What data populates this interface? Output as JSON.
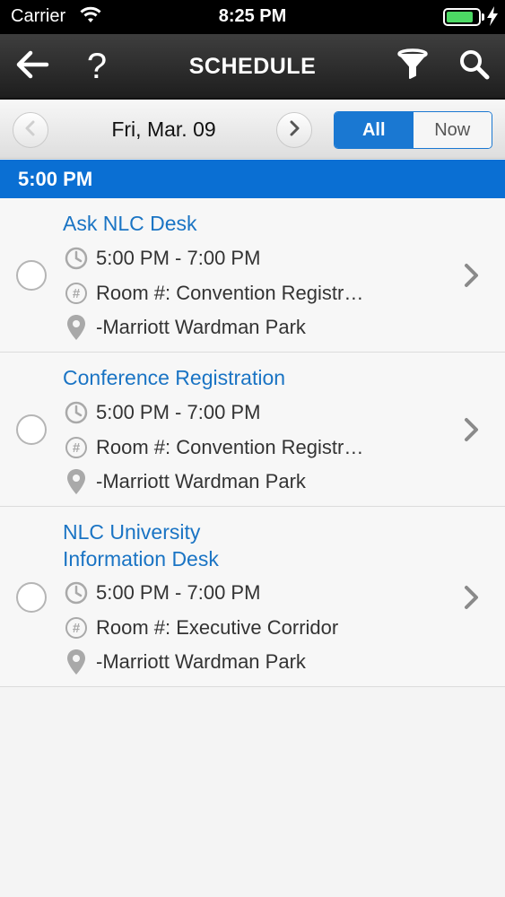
{
  "status_bar": {
    "carrier": "Carrier",
    "time": "8:25 PM",
    "battery_level": 0.85
  },
  "navbar": {
    "title": "SCHEDULE",
    "help_label": "?",
    "icons": [
      "back-arrow-icon",
      "help-icon",
      "filter-icon",
      "search-icon"
    ]
  },
  "datebar": {
    "date": "Fri, Mar. 09",
    "segments": [
      {
        "label": "All",
        "selected": true
      },
      {
        "label": "Now",
        "selected": false
      }
    ]
  },
  "section": {
    "time": "5:00 PM"
  },
  "sessions": [
    {
      "title_lines": [
        "Ask NLC Desk"
      ],
      "time": "5:00 PM - 7:00 PM",
      "room": "Room #: Convention Registr…",
      "location": "-Marriott Wardman Park"
    },
    {
      "title_lines": [
        "Conference Registration"
      ],
      "time": "5:00 PM - 7:00 PM",
      "room": "Room #: Convention Registr…",
      "location": "-Marriott Wardman Park"
    },
    {
      "title_lines": [
        "NLC University",
        "Information Desk"
      ],
      "time": "5:00 PM - 7:00 PM",
      "room": "Room #: Executive Corridor",
      "location": "-Marriott Wardman Park"
    }
  ],
  "colors": {
    "accent": "#0a6fd3",
    "title_blue": "#1a74c4",
    "navbar": "#2b2b2b",
    "battery": "#4cd964"
  }
}
